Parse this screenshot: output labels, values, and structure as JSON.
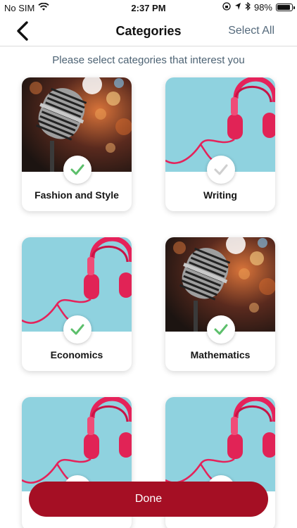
{
  "status_bar": {
    "carrier": "No SIM",
    "time": "2:37 PM",
    "battery": "98%",
    "battery_level": 0.98
  },
  "nav": {
    "title": "Categories",
    "select_all_label": "Select All",
    "back_icon": "chevron-left-icon"
  },
  "subtitle": "Please select categories that interest you",
  "colors": {
    "primary": "#a50f24",
    "check_selected": "#5cbf6b",
    "check_unselected": "#cfcfcf",
    "accent_text": "#556a7c"
  },
  "categories": [
    {
      "label": "Fashion and Style",
      "image": "microphone",
      "selected": true
    },
    {
      "label": "Writing",
      "image": "headphones",
      "selected": false
    },
    {
      "label": "Economics",
      "image": "headphones",
      "selected": true
    },
    {
      "label": "Mathematics",
      "image": "microphone",
      "selected": true
    },
    {
      "label": "",
      "image": "headphones",
      "selected": false
    },
    {
      "label": "",
      "image": "headphones",
      "selected": false
    }
  ],
  "done_label": "Done"
}
